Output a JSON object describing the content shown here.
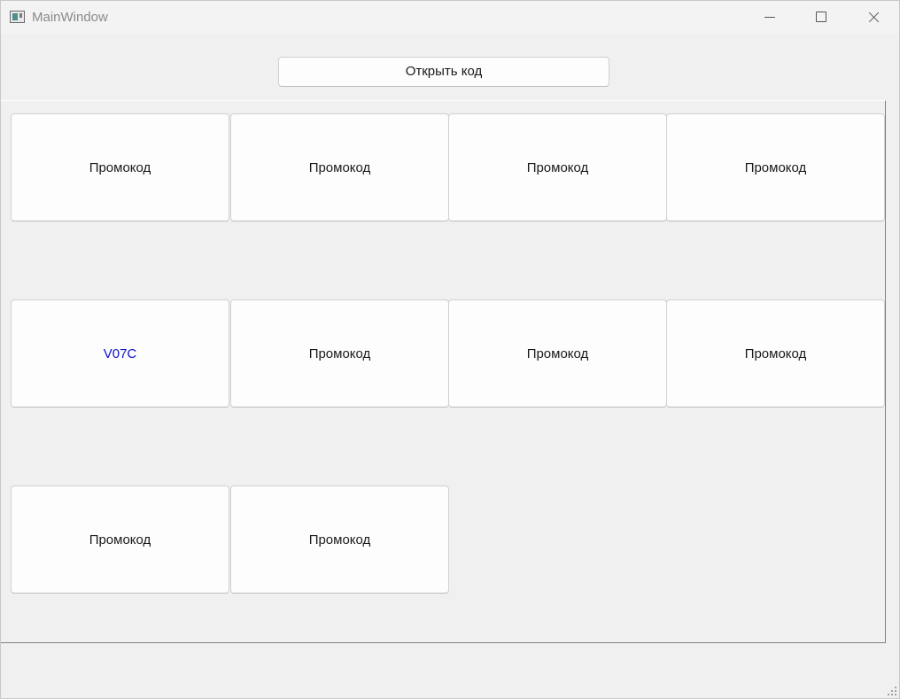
{
  "window": {
    "title": "MainWindow",
    "controls": {
      "minimize_icon": "minimize-icon",
      "maximize_icon": "maximize-icon",
      "close_icon": "close-icon"
    }
  },
  "toolbar": {
    "open_code_label": "Открыть код"
  },
  "codes": [
    {
      "label": "Промокод",
      "revealed": false
    },
    {
      "label": "Промокод",
      "revealed": false
    },
    {
      "label": "Промокод",
      "revealed": false
    },
    {
      "label": "Промокод",
      "revealed": false
    },
    {
      "label": "V07C",
      "revealed": true
    },
    {
      "label": "Промокод",
      "revealed": false
    },
    {
      "label": "Промокод",
      "revealed": false
    },
    {
      "label": "Промокод",
      "revealed": false
    },
    {
      "label": "Промокод",
      "revealed": false
    },
    {
      "label": "Промокод",
      "revealed": false
    }
  ],
  "colors": {
    "revealed_text": "#1010d0",
    "default_text": "#1a1a1a"
  }
}
